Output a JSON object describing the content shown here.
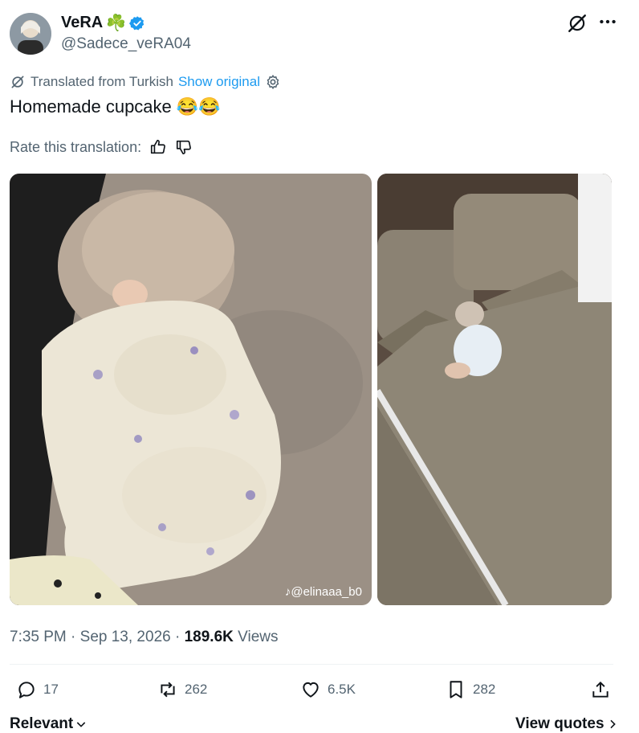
{
  "author": {
    "display_name": "VeRA",
    "name_emoji": "☘️",
    "handle": "@Sadece_veRA04"
  },
  "translation": {
    "label": "Translated from Turkish",
    "show_original": "Show original",
    "rate_label": "Rate this translation:"
  },
  "tweet": {
    "text": "Homemade cupcake",
    "emojis": "😂😂"
  },
  "media": {
    "watermark": "@elinaaa_b0"
  },
  "meta": {
    "time": "7:35 PM",
    "separator": "·",
    "date": "Sep 13, 2026",
    "views_count": "189.6K",
    "views_label": "Views"
  },
  "actions": {
    "replies": "17",
    "reposts": "262",
    "likes": "6.5K",
    "bookmarks": "282"
  },
  "footer": {
    "relevant": "Relevant",
    "view_quotes": "View quotes"
  },
  "colors": {
    "accent": "#1d9bf0",
    "muted": "#536471",
    "text": "#0f1419"
  }
}
